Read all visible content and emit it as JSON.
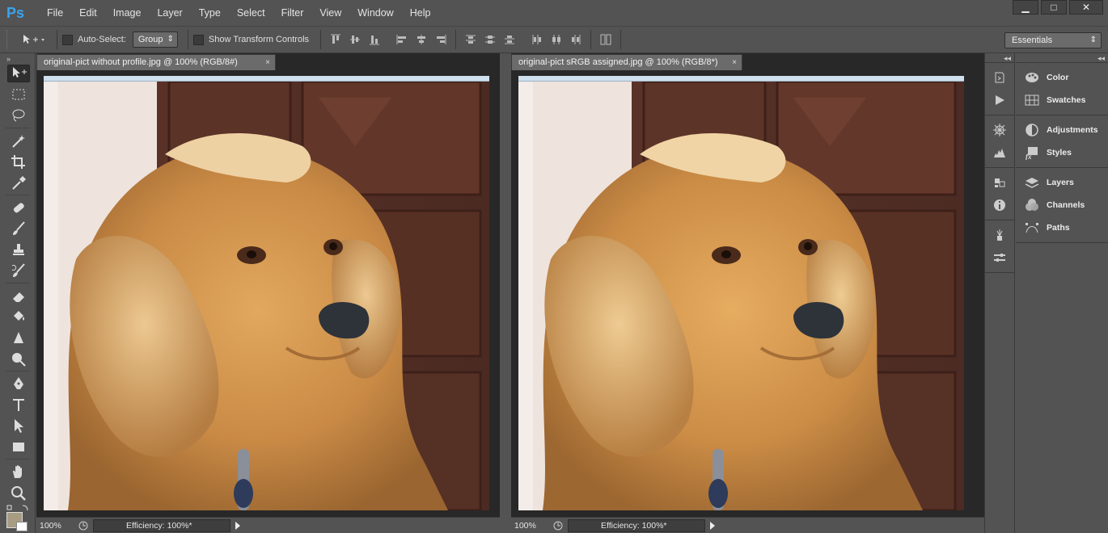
{
  "app": {
    "logo": "Ps"
  },
  "menu": [
    "File",
    "Edit",
    "Image",
    "Layer",
    "Type",
    "Select",
    "Filter",
    "View",
    "Window",
    "Help"
  ],
  "window_controls": {
    "minimize": "▁",
    "maximize": "□",
    "close": "✕"
  },
  "options_bar": {
    "auto_select_label": "Auto-Select:",
    "auto_select_value": "Group",
    "show_transform_label": "Show Transform Controls",
    "workspace": "Essentials"
  },
  "toolbox": {
    "collapse": "»",
    "tools": [
      "move-tool",
      "marquee-tool",
      "lasso-tool",
      "magic-wand-tool",
      "crop-tool",
      "eyedropper-tool",
      "healing-brush-tool",
      "brush-tool",
      "clone-stamp-tool",
      "history-brush-tool",
      "eraser-tool",
      "paint-bucket-tool",
      "sharpen-tool",
      "dodge-tool",
      "pen-tool",
      "type-tool",
      "path-selection-tool",
      "rectangle-tool",
      "hand-tool",
      "zoom-tool"
    ],
    "foreground_color": "#a89d82",
    "background_color": "#ffffff"
  },
  "documents": [
    {
      "title": "original-pict without profile.jpg @ 100% (RGB/8#)",
      "close": "×",
      "zoom": "100%",
      "status": "Efficiency: 100%*"
    },
    {
      "title": "original-pict sRGB assigned.jpg @ 100% (RGB/8*)",
      "close": "×",
      "zoom": "100%",
      "status": "Efficiency: 100%*"
    }
  ],
  "panels": {
    "collapse_icons": "◂◂",
    "collapse_labels": "◂◂",
    "groups": [
      [
        "Color",
        "Swatches"
      ],
      [
        "Adjustments",
        "Styles"
      ],
      [
        "Layers",
        "Channels",
        "Paths"
      ]
    ]
  }
}
